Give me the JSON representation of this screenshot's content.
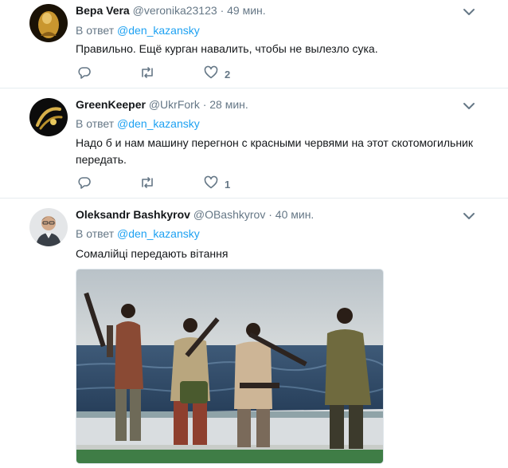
{
  "tweets": [
    {
      "name": "Вера Vera",
      "handle": "@veronika23123",
      "dot": "·",
      "time": "49 мин.",
      "reply_prefix": "В ответ",
      "reply_to": "@den_kazansky",
      "text": "Правильно. Ещё курган навалить, чтобы не вылезло сука.",
      "likes": "2"
    },
    {
      "name": "GreenKeeper",
      "handle": "@UkrFork",
      "dot": "·",
      "time": "28 мин.",
      "reply_prefix": "В ответ",
      "reply_to": "@den_kazansky",
      "text": "Надо б и нам машину перегнон с красными червями на этот скотомогильник передать.",
      "likes": "1"
    },
    {
      "name": "Oleksandr Bashkyrov",
      "handle": "@OBashkyrov",
      "dot": "·",
      "time": "40 мин.",
      "reply_prefix": "В ответ",
      "reply_to": "@den_kazansky",
      "text": "Сомалійці передають вітання"
    }
  ],
  "colors": {
    "accent": "#1da1f2",
    "muted": "#657786",
    "text": "#14171a",
    "divider": "#e6ecf0"
  },
  "icons": [
    "chevron-down-icon",
    "reply-icon",
    "retweet-icon",
    "heart-icon"
  ]
}
